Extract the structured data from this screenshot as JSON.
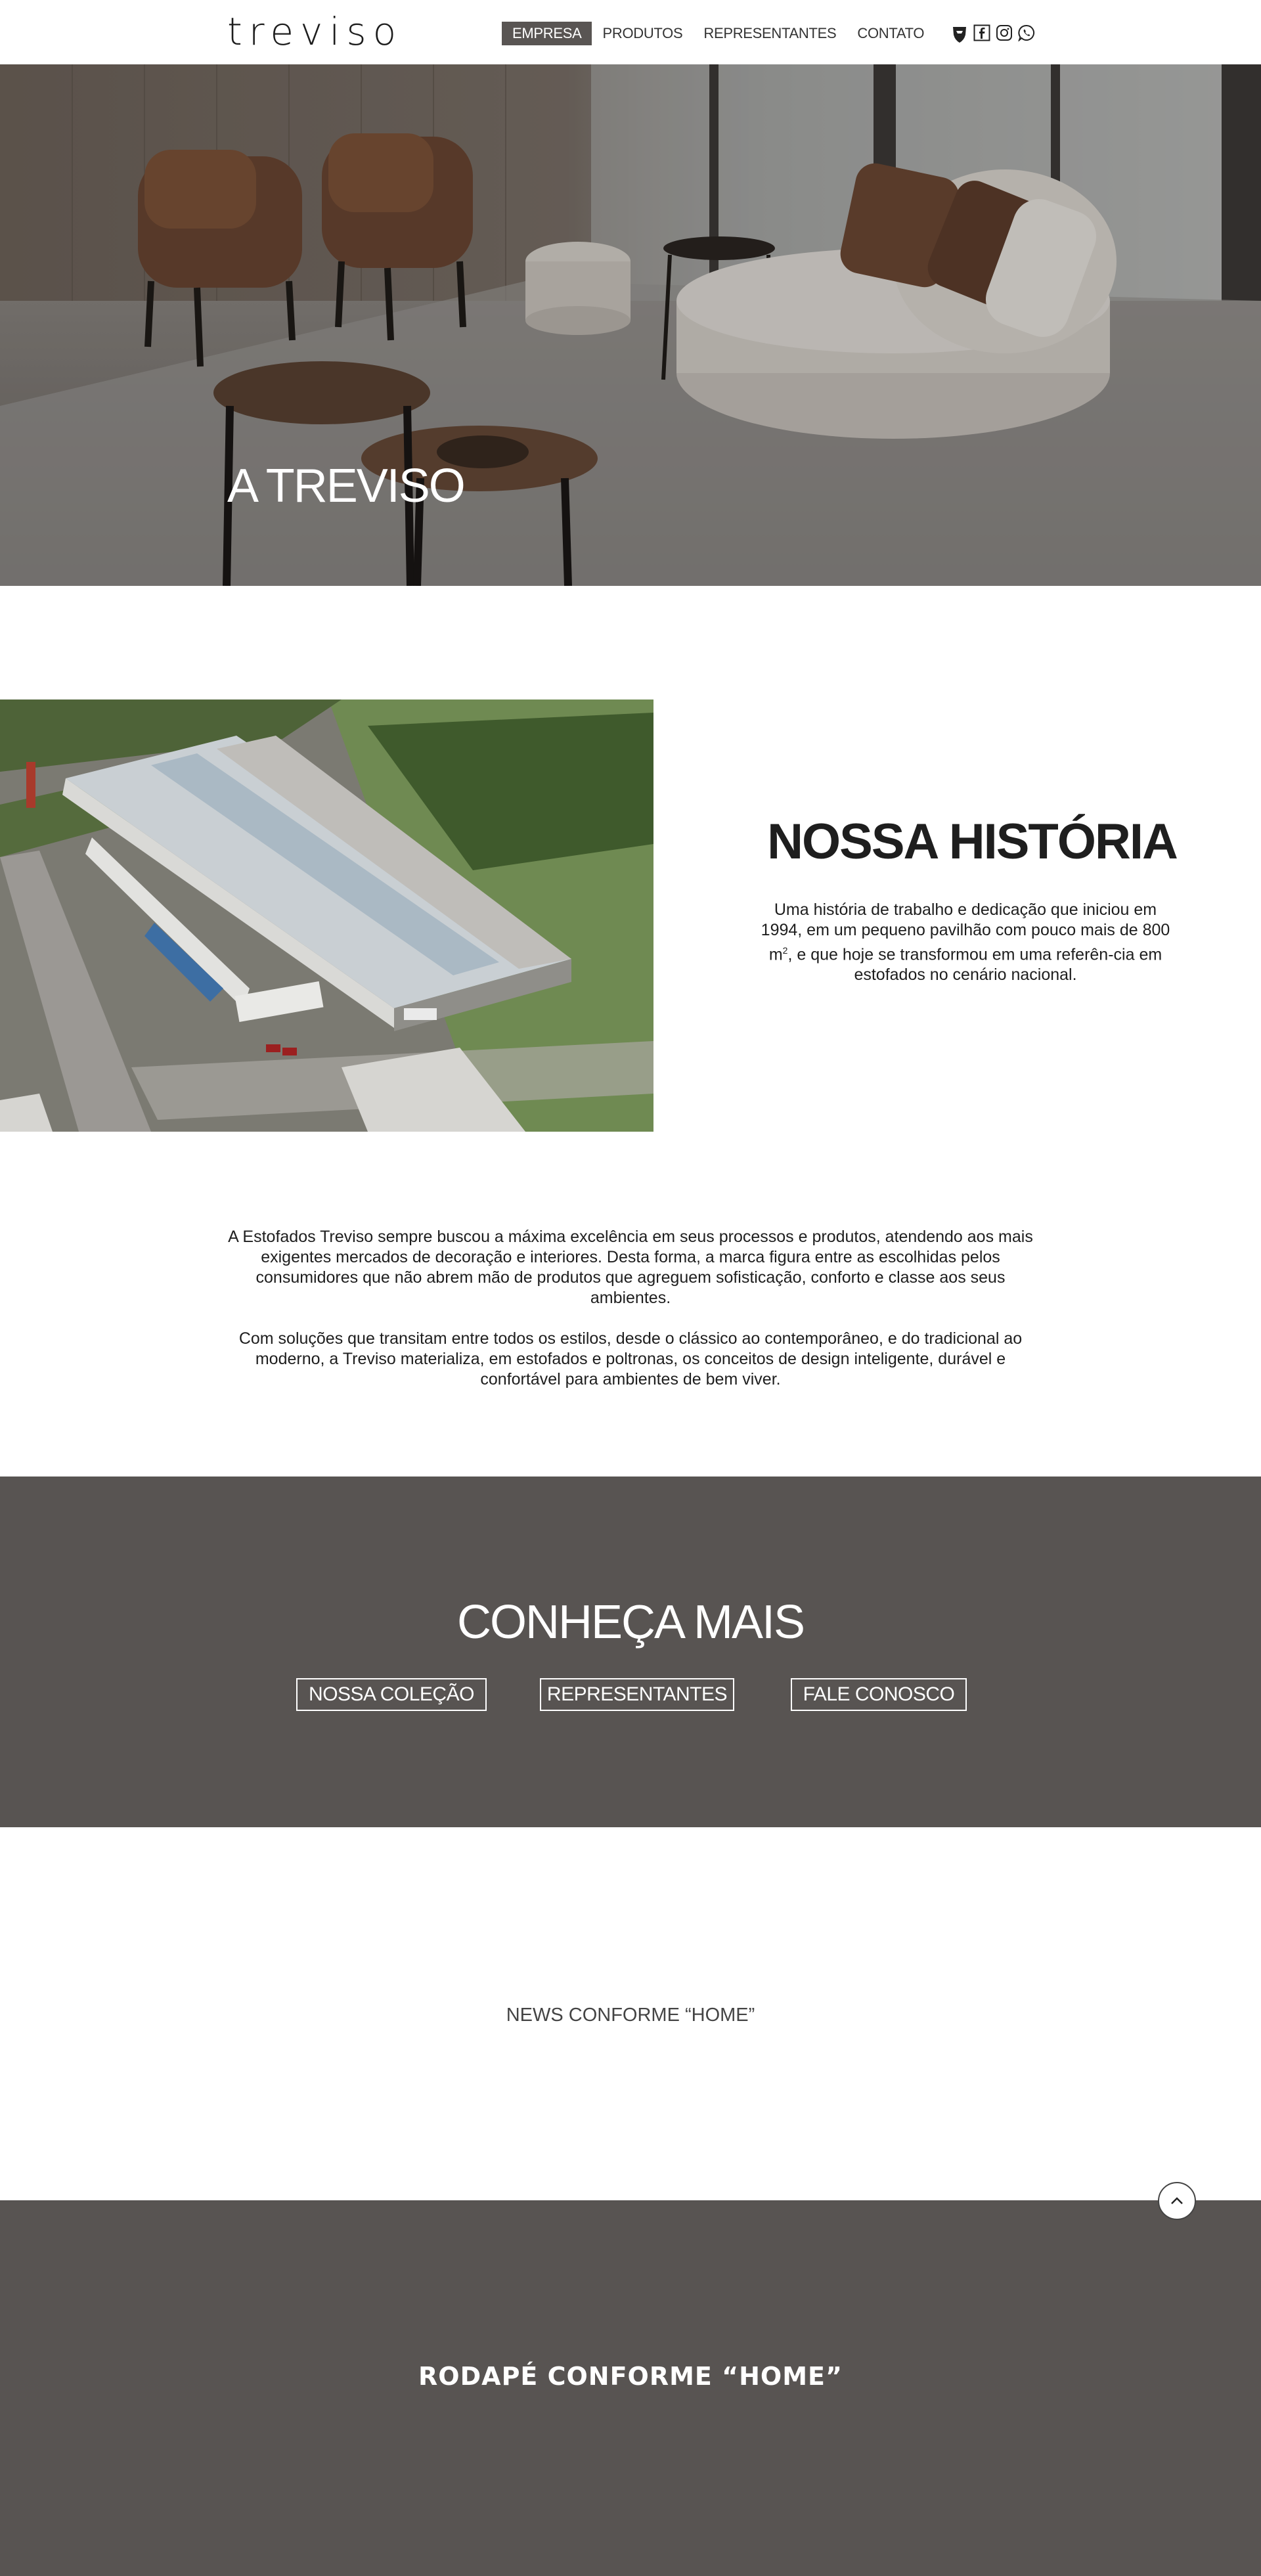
{
  "header": {
    "logo": "treviso",
    "nav": [
      {
        "label": "EMPRESA",
        "active": true
      },
      {
        "label": "PRODUTOS",
        "active": false
      },
      {
        "label": "REPRESENTANTES",
        "active": false
      },
      {
        "label": "CONTATO",
        "active": false
      }
    ],
    "social_icons": [
      "shield-logo-icon",
      "facebook-icon",
      "instagram-icon",
      "whatsapp-icon"
    ]
  },
  "hero": {
    "title": "A TREVISO"
  },
  "history": {
    "title": "NOSSA HISTÓRIA",
    "text_before_sup": "Uma história de trabalho e dedicação que iniciou em 1994, em um pequeno pavilhão com pouco mais de 800 m",
    "sup": "2",
    "text_after_sup": ", e que hoje se transformou em uma referên-cia em estofados no cenário nacional."
  },
  "about": {
    "paragraph_1": "A Estofados Treviso sempre buscou a máxima excelência em seus processos e produtos, atendendo aos mais exigentes mercados de decoração e interiores. Desta forma, a marca figura entre as escolhidas pelos consumidores que não abrem mão de produtos que agreguem sofisticação, conforto e classe aos seus ambientes.",
    "paragraph_2": "Com soluções que transitam entre todos os estilos, desde o clássico ao contemporâneo, e do tradicional ao moderno, a Treviso materializa, em estofados e poltronas, os conceitos de design inteligente, durável e confortável para ambientes de bem viver."
  },
  "know_more": {
    "title": "CONHEÇA MAIS",
    "buttons": [
      "NOSSA COLEÇÃO",
      "REPRESENTANTES",
      "FALE CONOSCO"
    ]
  },
  "news": {
    "placeholder": "NEWS CONFORME “HOME”"
  },
  "footer": {
    "placeholder": "RODAPÉ CONFORME “HOME”"
  },
  "colors": {
    "dark_section": "#585452",
    "active_nav": "#595553",
    "text": "#1e1e1e"
  }
}
